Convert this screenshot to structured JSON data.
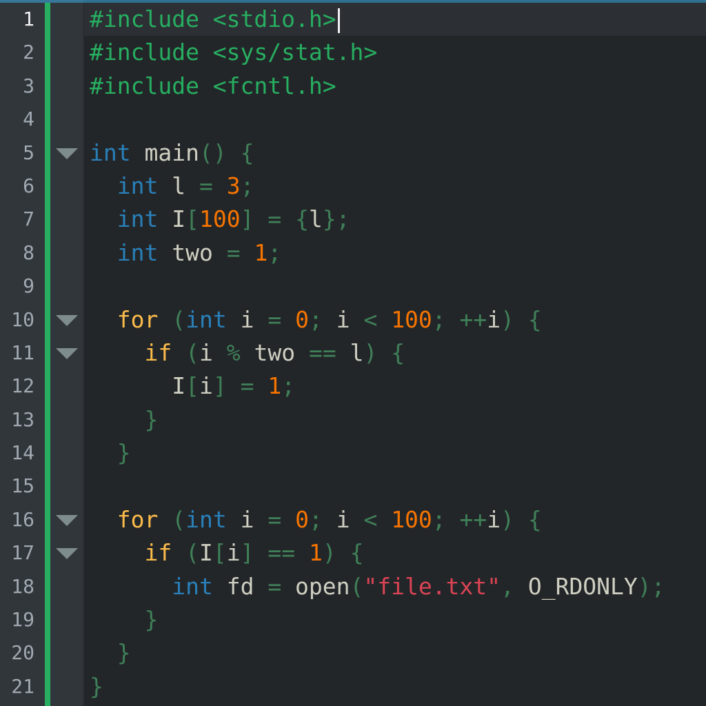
{
  "editor": {
    "colors": {
      "background": "#232629",
      "gutter": "#31363b",
      "modified_marker": "#27ae60",
      "preprocessor": "#27ae60",
      "keyword": "#2980b9",
      "control_flow": "#fdbc4b",
      "number": "#f67400",
      "string": "#da4453",
      "operator": "#3f8058",
      "identifier": "#cfcfc2"
    },
    "current_line": 1,
    "fold_icon": "fold-arrow-down-icon",
    "lines": [
      {
        "n": "1",
        "fold": false,
        "tokens": [
          {
            "t": "pre",
            "v": "#include <stdio.h>"
          }
        ]
      },
      {
        "n": "2",
        "fold": false,
        "tokens": [
          {
            "t": "pre",
            "v": "#include <sys/stat.h>"
          }
        ]
      },
      {
        "n": "3",
        "fold": false,
        "tokens": [
          {
            "t": "pre",
            "v": "#include <fcntl.h>"
          }
        ]
      },
      {
        "n": "4",
        "fold": false,
        "tokens": []
      },
      {
        "n": "5",
        "fold": true,
        "tokens": [
          {
            "t": "kw",
            "v": "int"
          },
          {
            "t": "id",
            "v": " main"
          },
          {
            "t": "op",
            "v": "() {"
          }
        ]
      },
      {
        "n": "6",
        "fold": false,
        "tokens": [
          {
            "t": "id",
            "v": "  "
          },
          {
            "t": "kw",
            "v": "int"
          },
          {
            "t": "id",
            "v": " l "
          },
          {
            "t": "op",
            "v": "="
          },
          {
            "t": "id",
            "v": " "
          },
          {
            "t": "num",
            "v": "3"
          },
          {
            "t": "op",
            "v": ";"
          }
        ]
      },
      {
        "n": "7",
        "fold": false,
        "tokens": [
          {
            "t": "id",
            "v": "  "
          },
          {
            "t": "kw",
            "v": "int"
          },
          {
            "t": "id",
            "v": " I"
          },
          {
            "t": "op",
            "v": "["
          },
          {
            "t": "num",
            "v": "100"
          },
          {
            "t": "op",
            "v": "] = {"
          },
          {
            "t": "id",
            "v": "l"
          },
          {
            "t": "op",
            "v": "};"
          }
        ]
      },
      {
        "n": "8",
        "fold": false,
        "tokens": [
          {
            "t": "id",
            "v": "  "
          },
          {
            "t": "kw",
            "v": "int"
          },
          {
            "t": "id",
            "v": " two "
          },
          {
            "t": "op",
            "v": "="
          },
          {
            "t": "id",
            "v": " "
          },
          {
            "t": "num",
            "v": "1"
          },
          {
            "t": "op",
            "v": ";"
          }
        ]
      },
      {
        "n": "9",
        "fold": false,
        "tokens": []
      },
      {
        "n": "10",
        "fold": true,
        "tokens": [
          {
            "t": "id",
            "v": "  "
          },
          {
            "t": "ctl",
            "v": "for"
          },
          {
            "t": "id",
            "v": " "
          },
          {
            "t": "op",
            "v": "("
          },
          {
            "t": "kw",
            "v": "int"
          },
          {
            "t": "id",
            "v": " i "
          },
          {
            "t": "op",
            "v": "="
          },
          {
            "t": "id",
            "v": " "
          },
          {
            "t": "num",
            "v": "0"
          },
          {
            "t": "op",
            "v": ";"
          },
          {
            "t": "id",
            "v": " i "
          },
          {
            "t": "op",
            "v": "<"
          },
          {
            "t": "id",
            "v": " "
          },
          {
            "t": "num",
            "v": "100"
          },
          {
            "t": "op",
            "v": "; ++"
          },
          {
            "t": "id",
            "v": "i"
          },
          {
            "t": "op",
            "v": ") {"
          }
        ]
      },
      {
        "n": "11",
        "fold": true,
        "tokens": [
          {
            "t": "id",
            "v": "    "
          },
          {
            "t": "ctl",
            "v": "if"
          },
          {
            "t": "id",
            "v": " "
          },
          {
            "t": "op",
            "v": "("
          },
          {
            "t": "id",
            "v": "i "
          },
          {
            "t": "op",
            "v": "%"
          },
          {
            "t": "id",
            "v": " two "
          },
          {
            "t": "op",
            "v": "=="
          },
          {
            "t": "id",
            "v": " l"
          },
          {
            "t": "op",
            "v": ") {"
          }
        ]
      },
      {
        "n": "12",
        "fold": false,
        "tokens": [
          {
            "t": "id",
            "v": "      I"
          },
          {
            "t": "op",
            "v": "["
          },
          {
            "t": "id",
            "v": "i"
          },
          {
            "t": "op",
            "v": "] ="
          },
          {
            "t": "id",
            "v": " "
          },
          {
            "t": "num",
            "v": "1"
          },
          {
            "t": "op",
            "v": ";"
          }
        ]
      },
      {
        "n": "13",
        "fold": false,
        "tokens": [
          {
            "t": "id",
            "v": "    "
          },
          {
            "t": "op",
            "v": "}"
          }
        ]
      },
      {
        "n": "14",
        "fold": false,
        "tokens": [
          {
            "t": "id",
            "v": "  "
          },
          {
            "t": "op",
            "v": "}"
          }
        ]
      },
      {
        "n": "15",
        "fold": false,
        "tokens": []
      },
      {
        "n": "16",
        "fold": true,
        "tokens": [
          {
            "t": "id",
            "v": "  "
          },
          {
            "t": "ctl",
            "v": "for"
          },
          {
            "t": "id",
            "v": " "
          },
          {
            "t": "op",
            "v": "("
          },
          {
            "t": "kw",
            "v": "int"
          },
          {
            "t": "id",
            "v": " i "
          },
          {
            "t": "op",
            "v": "="
          },
          {
            "t": "id",
            "v": " "
          },
          {
            "t": "num",
            "v": "0"
          },
          {
            "t": "op",
            "v": ";"
          },
          {
            "t": "id",
            "v": " i "
          },
          {
            "t": "op",
            "v": "<"
          },
          {
            "t": "id",
            "v": " "
          },
          {
            "t": "num",
            "v": "100"
          },
          {
            "t": "op",
            "v": "; ++"
          },
          {
            "t": "id",
            "v": "i"
          },
          {
            "t": "op",
            "v": ") {"
          }
        ]
      },
      {
        "n": "17",
        "fold": true,
        "tokens": [
          {
            "t": "id",
            "v": "    "
          },
          {
            "t": "ctl",
            "v": "if"
          },
          {
            "t": "id",
            "v": " "
          },
          {
            "t": "op",
            "v": "("
          },
          {
            "t": "id",
            "v": "I"
          },
          {
            "t": "op",
            "v": "["
          },
          {
            "t": "id",
            "v": "i"
          },
          {
            "t": "op",
            "v": "] =="
          },
          {
            "t": "id",
            "v": " "
          },
          {
            "t": "num",
            "v": "1"
          },
          {
            "t": "op",
            "v": ") {"
          }
        ]
      },
      {
        "n": "18",
        "fold": false,
        "tokens": [
          {
            "t": "id",
            "v": "      "
          },
          {
            "t": "kw",
            "v": "int"
          },
          {
            "t": "id",
            "v": " fd "
          },
          {
            "t": "op",
            "v": "="
          },
          {
            "t": "id",
            "v": " open"
          },
          {
            "t": "op",
            "v": "("
          },
          {
            "t": "str",
            "v": "\"file.txt\""
          },
          {
            "t": "op",
            "v": ","
          },
          {
            "t": "id",
            "v": " O_RDONLY"
          },
          {
            "t": "op",
            "v": ");"
          }
        ]
      },
      {
        "n": "19",
        "fold": false,
        "tokens": [
          {
            "t": "id",
            "v": "    "
          },
          {
            "t": "op",
            "v": "}"
          }
        ]
      },
      {
        "n": "20",
        "fold": false,
        "tokens": [
          {
            "t": "id",
            "v": "  "
          },
          {
            "t": "op",
            "v": "}"
          }
        ]
      },
      {
        "n": "21",
        "fold": false,
        "tokens": [
          {
            "t": "op",
            "v": "}"
          }
        ]
      }
    ]
  }
}
